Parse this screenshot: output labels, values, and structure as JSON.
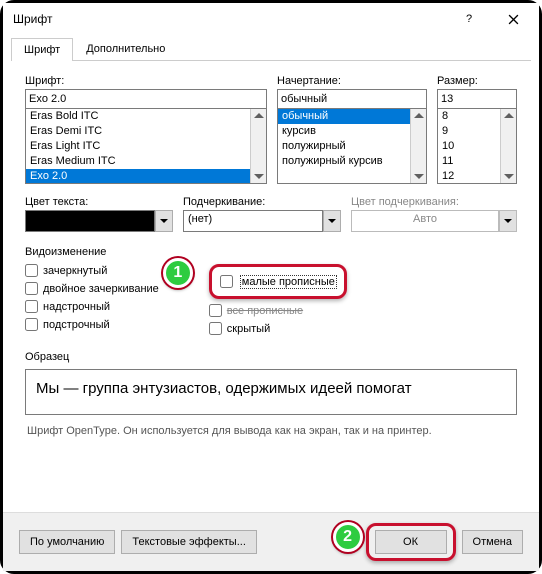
{
  "title": "Шрифт",
  "tabs": {
    "font": "Шрифт",
    "advanced": "Дополнительно"
  },
  "labels": {
    "font": "Шрифт:",
    "style": "Начертание:",
    "size": "Размер:",
    "textColor": "Цвет текста:",
    "underline": "Подчеркивание:",
    "underlineColor": "Цвет подчеркивания:",
    "effects": "Видоизменение",
    "preview": "Образец"
  },
  "font": {
    "value": "Exo 2.0",
    "items": [
      "Eras Bold ITC",
      "Eras Demi ITC",
      "Eras Light ITC",
      "Eras Medium ITC",
      "Exo 2.0"
    ]
  },
  "style": {
    "value": "обычный",
    "items": [
      "обычный",
      "курсив",
      "полужирный",
      "полужирный курсив"
    ]
  },
  "size": {
    "value": "13",
    "items": [
      "8",
      "9",
      "10",
      "11",
      "12"
    ]
  },
  "underline": {
    "value": "(нет)",
    "colorValue": "Авто"
  },
  "effects": {
    "strike": "зачеркнутый",
    "doubleStrike": "двойное зачеркивание",
    "superscript": "надстрочный",
    "subscript": "подстрочный",
    "smallCaps": "малые прописные",
    "allCaps": "все прописные",
    "hidden": "скрытый"
  },
  "previewText": "Мы — группа энтузиастов, одержимых идеей помогат",
  "footnote": "Шрифт OpenType. Он используется для вывода как на экран, так и на принтер.",
  "buttons": {
    "default": "По умолчанию",
    "textEffects": "Текстовые эффекты...",
    "ok": "ОК",
    "cancel": "Отмена"
  },
  "badges": {
    "one": "1",
    "two": "2"
  }
}
